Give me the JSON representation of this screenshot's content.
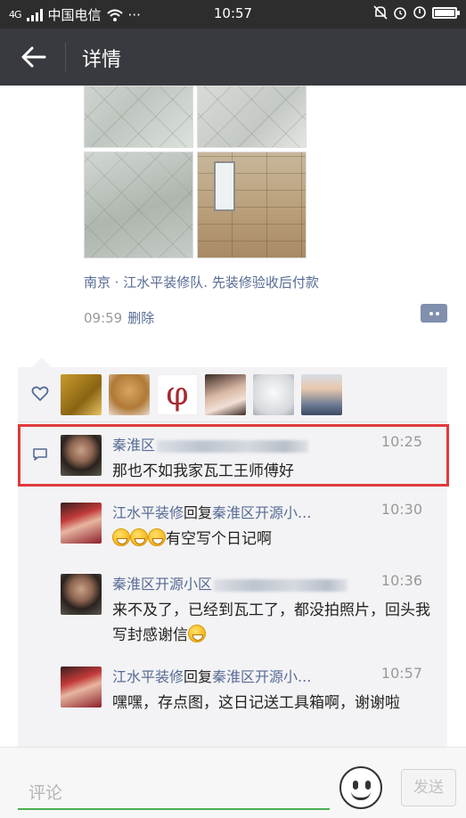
{
  "status_bar": {
    "signal": "4G",
    "carrier": "中国电信",
    "time": "10:57"
  },
  "nav": {
    "title": "详情"
  },
  "post": {
    "location": "南京 · 江水平装修队. 先装修验收后付款",
    "time": "09:59",
    "delete_label": "删除"
  },
  "likes": {
    "avatars": [
      "like-avatar-1",
      "like-avatar-2",
      "like-avatar-3",
      "like-avatar-4",
      "like-avatar-5",
      "like-avatar-6"
    ]
  },
  "comments": [
    {
      "name": "秦淮区",
      "time": "10:25",
      "text": "那也不如我家瓦工王师傅好"
    },
    {
      "name": "江水平装修",
      "reply_label": "回复",
      "reply_to": "秦淮区开源小...",
      "time": "10:30",
      "text": "有空写个日记啊"
    },
    {
      "name": "秦淮区开源小区",
      "time": "10:36",
      "text": "来不及了，已经到瓦工了，都没拍照片，回头我写封感谢信"
    },
    {
      "name": "江水平装修",
      "reply_label": "回复",
      "reply_to": "秦淮区开源小...",
      "time": "10:57",
      "text": "嘿嘿，存点图，这日记送工具箱啊，谢谢啦"
    }
  ],
  "composer": {
    "placeholder": "评论",
    "send_label": "发送"
  },
  "colors": {
    "link": "#576b95",
    "nav_bg": "#393a3f",
    "status_bg": "#2d2d2d",
    "highlight": "#e03a3a",
    "input_underline": "#4caf50"
  }
}
